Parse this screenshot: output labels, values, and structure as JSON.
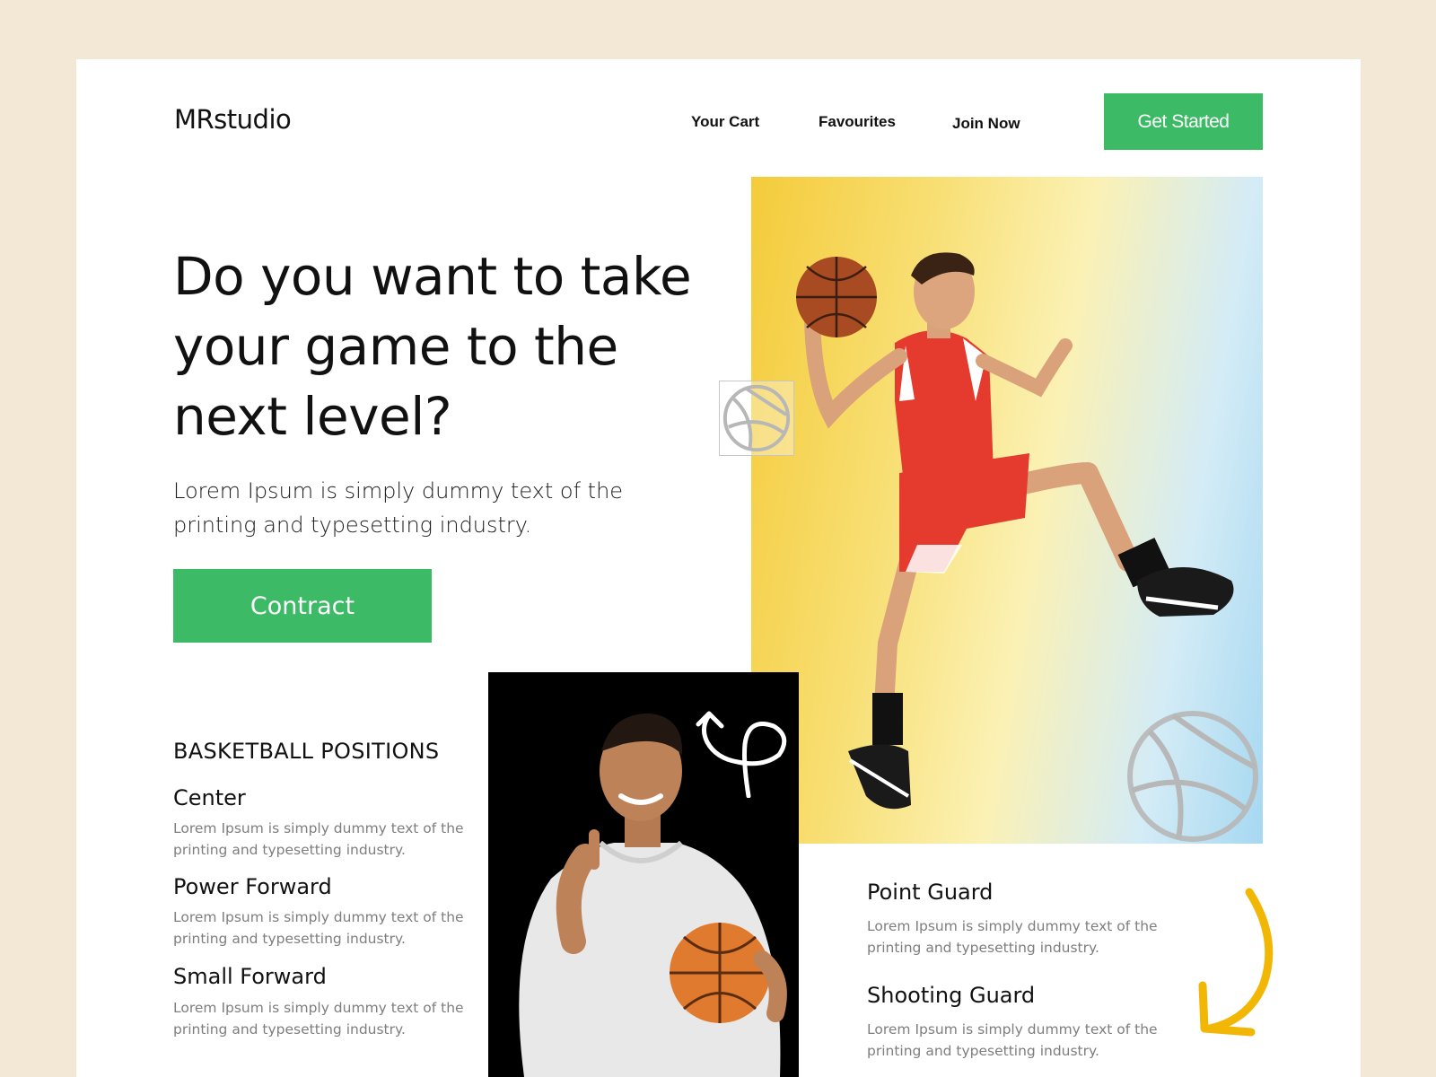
{
  "brand": {
    "logo": "MRstudio"
  },
  "nav": {
    "items": [
      {
        "label": "Your Cart"
      },
      {
        "label": "Favourites"
      },
      {
        "label": "Join Now"
      }
    ],
    "cta_label": "Get Started"
  },
  "hero": {
    "title": "Do you want to take your game to the next level?",
    "subtitle": "Lorem Ipsum is simply dummy text of the printing and typesetting industry.",
    "cta_label": "Contract"
  },
  "positions": {
    "title": "BASKETBALL POSITIONS",
    "items": [
      {
        "name": "Center",
        "desc": "Lorem Ipsum is simply dummy text of the printing and typesetting industry."
      },
      {
        "name": "Power Forward",
        "desc": "Lorem Ipsum is simply dummy text of the printing and typesetting industry."
      },
      {
        "name": "Small Forward",
        "desc": "Lorem Ipsum is simply dummy text of the printing and typesetting industry."
      },
      {
        "name": "Point Guard",
        "desc": "Lorem Ipsum is simply dummy text of the printing and typesetting industry."
      },
      {
        "name": "Shooting Guard",
        "desc": "Lorem Ipsum is simply dummy text of the printing and typesetting industry."
      }
    ]
  },
  "colors": {
    "page_bg": "#f3e8d6",
    "accent_green": "#3dba66",
    "doodle_yellow": "#f2b705",
    "jersey_red": "#e53a2e",
    "ball_orange": "#e07a2e"
  },
  "icons": [
    "basketball-icon",
    "arrow-doodle-icon",
    "curved-arrow-icon"
  ]
}
